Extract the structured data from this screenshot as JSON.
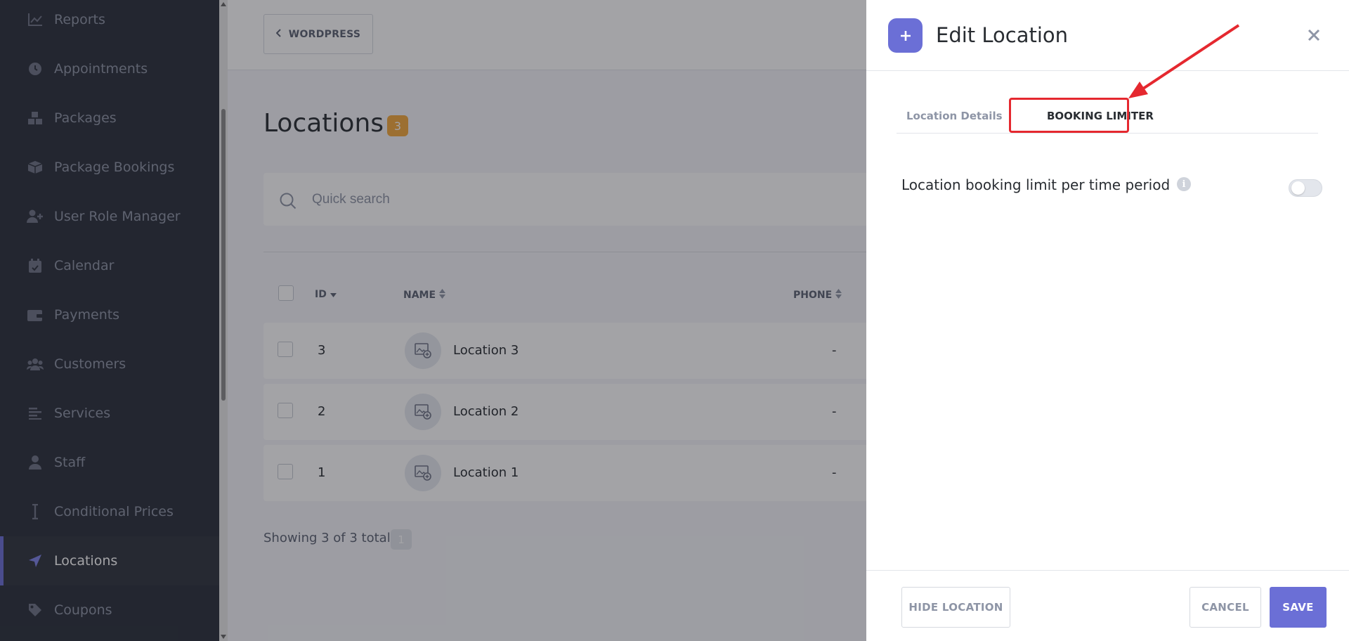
{
  "sidebar": {
    "items": [
      {
        "label": "Reports",
        "icon": "chart-icon"
      },
      {
        "label": "Appointments",
        "icon": "clock-icon"
      },
      {
        "label": "Packages",
        "icon": "boxes-icon"
      },
      {
        "label": "Package Bookings",
        "icon": "box-icon"
      },
      {
        "label": "User Role Manager",
        "icon": "user-plus-icon"
      },
      {
        "label": "Calendar",
        "icon": "calendar-icon"
      },
      {
        "label": "Payments",
        "icon": "wallet-icon"
      },
      {
        "label": "Customers",
        "icon": "users-icon"
      },
      {
        "label": "Services",
        "icon": "list-icon"
      },
      {
        "label": "Staff",
        "icon": "user-icon"
      },
      {
        "label": "Conditional Prices",
        "icon": "cursor-icon"
      },
      {
        "label": "Locations",
        "icon": "location-arrow-icon",
        "active": true
      },
      {
        "label": "Coupons",
        "icon": "tag-icon"
      }
    ]
  },
  "topbar": {
    "back_label": "WORDPRESS"
  },
  "page": {
    "title": "Locations",
    "count": "3"
  },
  "search": {
    "placeholder": "Quick search"
  },
  "table": {
    "headers": {
      "id": "ID",
      "name": "NAME",
      "phone": "PHONE"
    },
    "rows": [
      {
        "id": "3",
        "name": "Location 3",
        "phone": "-"
      },
      {
        "id": "2",
        "name": "Location 2",
        "phone": "-"
      },
      {
        "id": "1",
        "name": "Location 1",
        "phone": "-"
      }
    ],
    "showing": "Showing 3 of 3 total",
    "page": "1"
  },
  "drawer": {
    "title": "Edit Location",
    "tabs": {
      "details": "Location Details",
      "limiter": "BOOKING LIMITER"
    },
    "setting_label": "Location booking limit per time period",
    "info_glyph": "i",
    "toggle_on": false,
    "buttons": {
      "hide": "HIDE LOCATION",
      "cancel": "CANCEL",
      "save": "SAVE"
    }
  },
  "colors": {
    "accent": "#6b6fd6",
    "badge": "#f3a93c",
    "annotation": "#e5282f",
    "sidebar_bg": "#2b303b"
  }
}
